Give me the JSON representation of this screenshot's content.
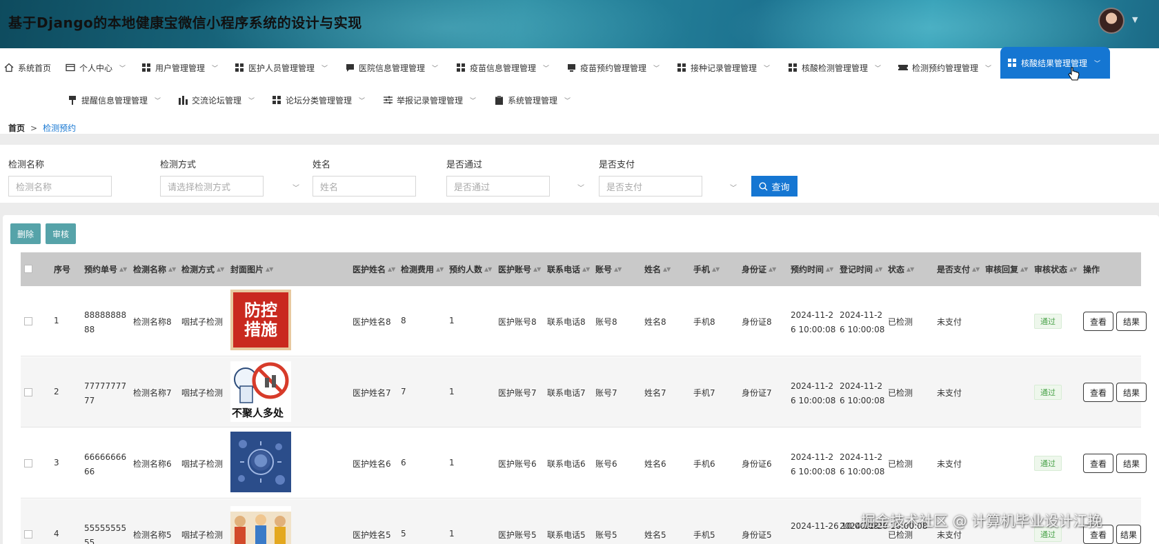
{
  "app": {
    "title": "基于Django的本地健康宝微信小程序系统的设计与实现"
  },
  "nav": {
    "row1": [
      {
        "label": "系统首页",
        "icon": "home-icon"
      },
      {
        "label": "个人中心",
        "icon": "card-icon"
      },
      {
        "label": "用户管理管理",
        "icon": "grid-icon"
      },
      {
        "label": "医护人员管理管理",
        "icon": "grid-icon"
      },
      {
        "label": "医院信息管理管理",
        "icon": "chat-icon"
      },
      {
        "label": "疫苗信息管理管理",
        "icon": "grid-icon"
      },
      {
        "label": "疫苗预约管理管理",
        "icon": "monitor-icon"
      },
      {
        "label": "接种记录管理管理",
        "icon": "grid-icon"
      },
      {
        "label": "核酸检测管理管理",
        "icon": "grid-icon"
      },
      {
        "label": "检测预约管理管理",
        "icon": "ticket-icon"
      },
      {
        "label": "核酸结果管理管理",
        "icon": "grid-icon"
      }
    ],
    "row2": [
      {
        "label": "提醒信息管理管理",
        "icon": "brush-icon"
      },
      {
        "label": "交流论坛管理",
        "icon": "bars-icon"
      },
      {
        "label": "论坛分类管理管理",
        "icon": "grid-icon"
      },
      {
        "label": "举报记录管理管理",
        "icon": "sliders-icon"
      },
      {
        "label": "系统管理管理",
        "icon": "clipboard-icon"
      }
    ]
  },
  "breadcrumb": {
    "home": "首页",
    "separator": ">",
    "current": "检测预约"
  },
  "search": {
    "fields": [
      {
        "label": "检测名称",
        "placeholder": "检测名称"
      },
      {
        "label": "检测方式",
        "placeholder": "请选择检测方式"
      },
      {
        "label": "姓名",
        "placeholder": "姓名"
      },
      {
        "label": "是否通过",
        "placeholder": "是否通过"
      },
      {
        "label": "是否支付",
        "placeholder": "是否支付"
      }
    ],
    "query_label": "查询"
  },
  "actions": {
    "delete_label": "删除",
    "review_label": "审核"
  },
  "table": {
    "headers": [
      "序号",
      "预约单号",
      "检测名称",
      "检测方式",
      "封面图片",
      "医护姓名",
      "检测费用",
      "预约人数",
      "医护账号",
      "联系电话",
      "账号",
      "姓名",
      "手机",
      "身份证",
      "预约时间",
      "登记时间",
      "状态",
      "是否支付",
      "审核回复",
      "审核状态",
      "操作"
    ],
    "rows": [
      {
        "no": "1",
        "order": "8888888888",
        "name": "检测名称8",
        "method": "咽拭子检测",
        "cover": "防控措施",
        "doctor": "医护姓名8",
        "fee": "8",
        "count": "1",
        "doc_account": "医护账号8",
        "phone": "联系电话8",
        "account": "账号8",
        "person": "姓名8",
        "mobile": "手机8",
        "idcard": "身份证8",
        "appt_time": "2024-11-26 10:00:08",
        "reg_time": "2024-11-26 10:00:08",
        "status": "已检测",
        "paid": "未支付",
        "reply": "",
        "review": "通过",
        "view": "查看",
        "result": "结果"
      },
      {
        "no": "2",
        "order": "7777777777",
        "name": "检测名称7",
        "method": "咽拭子检测",
        "cover": "不聚人多处",
        "doctor": "医护姓名7",
        "fee": "7",
        "count": "1",
        "doc_account": "医护账号7",
        "phone": "联系电话7",
        "account": "账号7",
        "person": "姓名7",
        "mobile": "手机7",
        "idcard": "身份证7",
        "appt_time": "2024-11-26 10:00:08",
        "reg_time": "2024-11-26 10:00:08",
        "status": "已检测",
        "paid": "未支付",
        "reply": "",
        "review": "通过",
        "view": "查看",
        "result": "结果"
      },
      {
        "no": "3",
        "order": "6666666666",
        "name": "检测名称6",
        "method": "咽拭子检测",
        "cover": "",
        "doctor": "医护姓名6",
        "fee": "6",
        "count": "1",
        "doc_account": "医护账号6",
        "phone": "联系电话6",
        "account": "账号6",
        "person": "姓名6",
        "mobile": "手机6",
        "idcard": "身份证6",
        "appt_time": "2024-11-26 10:00:08",
        "reg_time": "2024-11-26 10:00:08",
        "status": "已检测",
        "paid": "未支付",
        "reply": "",
        "review": "通过",
        "view": "查看",
        "result": "结果"
      },
      {
        "no": "4",
        "order": "5555555555",
        "name": "检测名称5",
        "method": "咽拭子检测",
        "cover": "",
        "doctor": "医护姓名5",
        "fee": "5",
        "count": "1",
        "doc_account": "医护账号5",
        "phone": "联系电话5",
        "account": "账号5",
        "person": "姓名5",
        "mobile": "手机5",
        "idcard": "身份证5",
        "appt_time": "2024-11-26 10:00:08",
        "reg_time": "2024-11-26 10:00:08",
        "status": "已检测",
        "paid": "未支付",
        "reply": "",
        "review": "通过",
        "view": "查看",
        "result": "结果"
      }
    ]
  },
  "watermark": "掘金技术社区 @ 计算机毕业设计江挽",
  "colors": {
    "primary": "#1576d2",
    "action": "#56a3a9",
    "header_dark": "#0e4b5e",
    "success": "#4aa34a"
  }
}
